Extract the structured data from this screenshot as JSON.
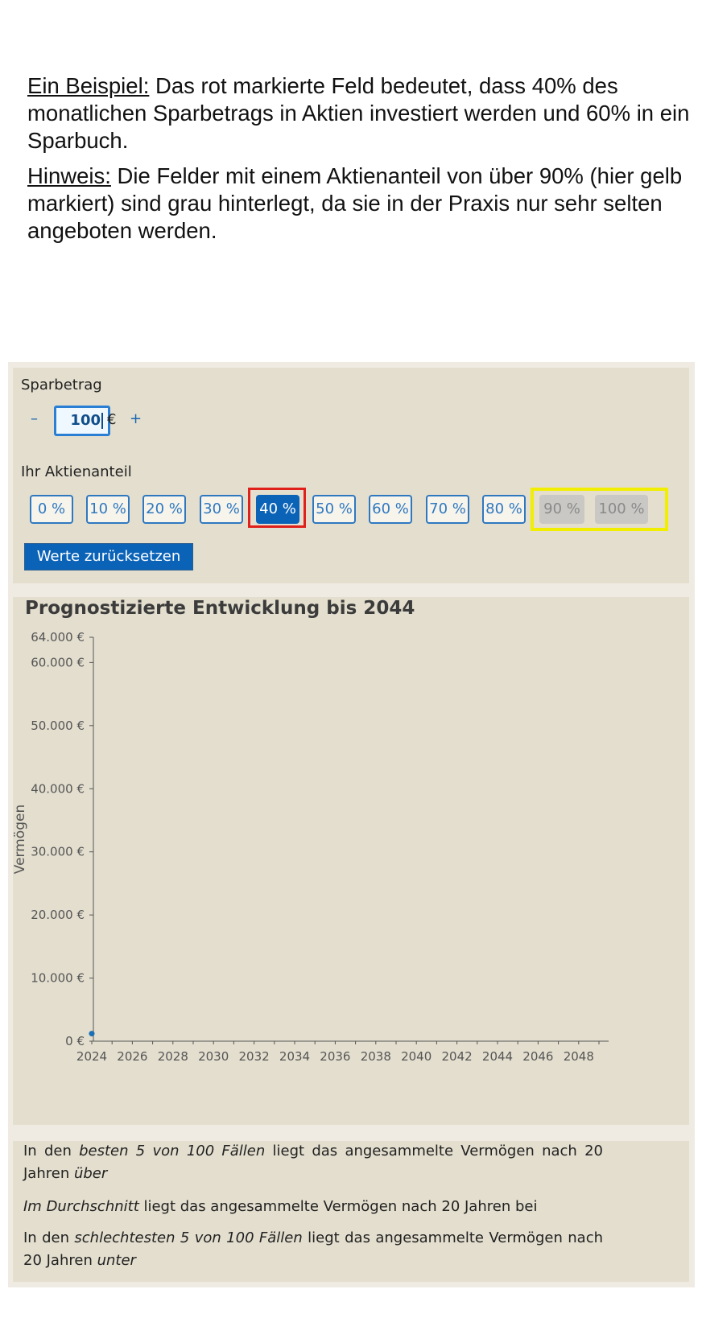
{
  "intro": {
    "example_heading": "Ein Beispiel:",
    "example_text": " Das rot markierte Feld bedeutet, dass 40% des monatlichen Sparbetrags in Aktien investiert werden und 60% in ein Sparbuch.",
    "hint_heading": "Hinweis:",
    "hint_text": " Die Felder mit einem Aktienanteil von über 90% (hier gelb markiert) sind grau hinterlegt, da sie in der Praxis nur sehr selten angeboten werden."
  },
  "savings": {
    "label": "Sparbetrag",
    "minus": "–",
    "value": "100",
    "currency": "€",
    "plus": "+"
  },
  "allocation": {
    "label": "Ihr Aktienanteil",
    "options": [
      "0 %",
      "10 %",
      "20 %",
      "30 %",
      "40 %",
      "50 %",
      "60 %",
      "70 %",
      "80 %",
      "90 %",
      "100 %"
    ],
    "selected": "40 %",
    "disabled": [
      "90 %",
      "100 %"
    ],
    "reset_label": "Werte zurücksetzen"
  },
  "chart_data": {
    "type": "line",
    "title": "Prognostizierte Entwicklung bis 2044",
    "ylabel": "Vermögen",
    "xlabel": "",
    "x_ticks": [
      "2024",
      "2026",
      "2028",
      "2030",
      "2032",
      "2034",
      "2036",
      "2038",
      "2040",
      "2042",
      "2044",
      "2046",
      "2048"
    ],
    "y_ticks": [
      "0 €",
      "10.000 €",
      "20.000 €",
      "30.000 €",
      "40.000 €",
      "50.000 €",
      "60.000 €",
      "64.000 €"
    ],
    "y_tick_values": [
      0,
      10000,
      20000,
      30000,
      40000,
      50000,
      60000,
      64000
    ],
    "xlim": [
      2024,
      2049
    ],
    "ylim": [
      0,
      64000
    ],
    "series": [
      {
        "points": [
          [
            2024,
            1200
          ]
        ]
      }
    ],
    "colors": {
      "point": "#1a6fb5",
      "axis": "#555555",
      "text": "#555555"
    }
  },
  "results": {
    "best": {
      "pre": "In den ",
      "em": "besten 5 von 100 Fällen",
      "mid": " liegt das angesammelte Vermögen nach 20 Jahren ",
      "em2": "über"
    },
    "avg": {
      "em": "Im Durchschnitt",
      "post": " liegt das angesammelte Vermögen nach 20 Jahren bei"
    },
    "worst": {
      "pre": "In den ",
      "em": "schlechtesten 5 von 100 Fällen",
      "mid": " liegt das angesammelte Vermögen nach 20 Jahren ",
      "em2": "unter"
    }
  }
}
